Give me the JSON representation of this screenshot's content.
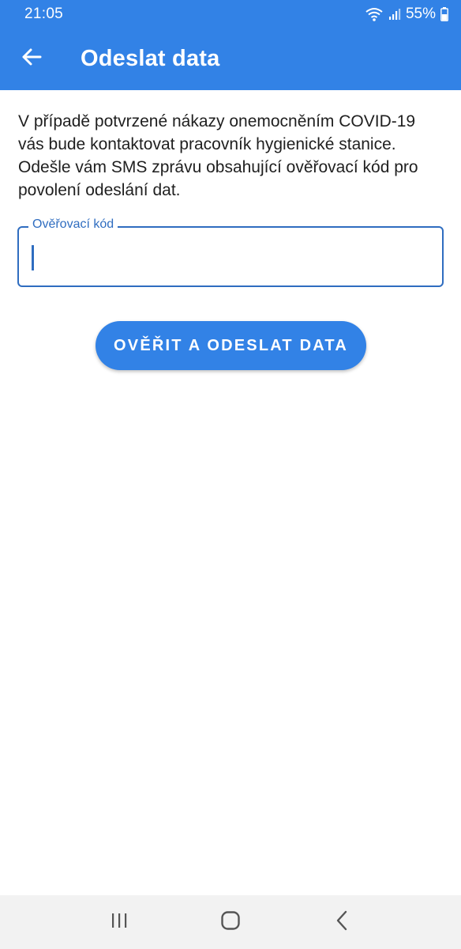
{
  "status_bar": {
    "time": "21:05",
    "battery_percent": "55%",
    "icons": [
      "wifi-icon",
      "signal-icon",
      "battery-icon"
    ]
  },
  "app_bar": {
    "title": "Odeslat data",
    "back_icon": "arrow-back-icon"
  },
  "content": {
    "description": "V případě potvrzené nákazy onemocněním COVID-19 vás bude kontaktovat pracovník hygienické stanice. Odešle vám SMS zprávu obsahující ověřovací kód pro povolení odeslání dat.",
    "code_field": {
      "label": "Ověřovací kód",
      "value": ""
    },
    "submit_label": "OVĚŘIT A ODESLAT DATA"
  },
  "nav_bar": {
    "icons": [
      "recents-icon",
      "home-icon",
      "back-icon"
    ]
  },
  "colors": {
    "primary": "#3282e6",
    "field_border": "#2f6dc0",
    "text": "#1f1f1f",
    "nav_bg": "#f2f2f2"
  }
}
